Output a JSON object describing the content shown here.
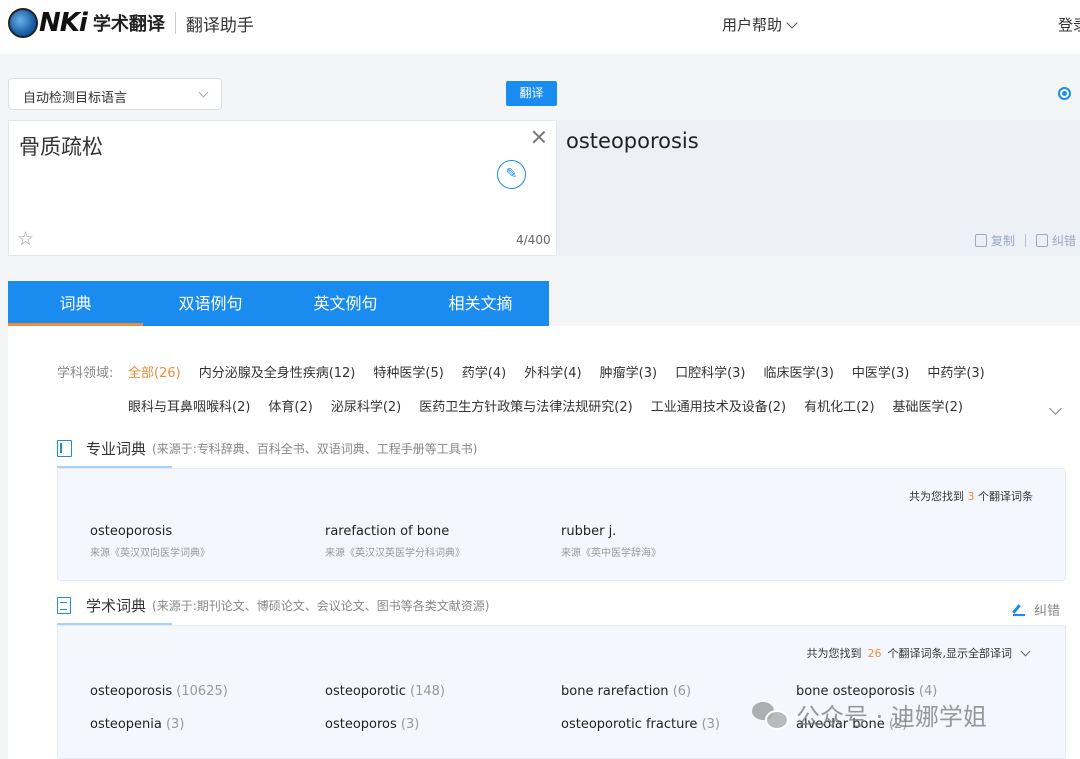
{
  "header": {
    "logo_text": "NKi",
    "app_name": "学术翻译",
    "sub_name": "翻译助手",
    "help_label": "用户帮助",
    "login_label": "登录"
  },
  "controls": {
    "target_language": "自动检测目标语言",
    "translate_label": "翻译"
  },
  "source": {
    "text": "骨质疏松",
    "char_count": "4/400"
  },
  "target": {
    "text": "osteoporosis",
    "copy_label": "复制",
    "correct_label": "纠错"
  },
  "tabs": [
    {
      "label": "词典",
      "active": true
    },
    {
      "label": "双语例句",
      "active": false
    },
    {
      "label": "英文例句",
      "active": false
    },
    {
      "label": "相关文摘",
      "active": false
    }
  ],
  "subjects": {
    "label": "学科领域:",
    "row1": [
      "全部(26)",
      "内分泌腺及全身性疾病(12)",
      "特种医学(5)",
      "药学(4)",
      "外科学(4)",
      "肿瘤学(3)",
      "口腔科学(3)",
      "临床医学(3)",
      "中医学(3)",
      "中药学(3)"
    ],
    "row2": [
      "眼科与耳鼻咽喉科(2)",
      "体育(2)",
      "泌尿科学(2)",
      "医药卫生方针政策与法律法规研究(2)",
      "工业通用技术及设备(2)",
      "有机化工(2)",
      "基础医学(2)"
    ]
  },
  "professional_dict": {
    "title": "专业词典",
    "source_note": "(来源于:专科辞典、百科全书、双语词典、工程手册等工具书)",
    "found_prefix": "共为您找到",
    "found_count": "3",
    "found_suffix": "个翻译词条",
    "terms": [
      {
        "term": "osteoporosis",
        "source": "来源《英汉双向医学词典》"
      },
      {
        "term": "rarefaction of bone",
        "source": "来源《英汉汉英医学分科词典》"
      },
      {
        "term": "rubber j.",
        "source": "来源《英中医学辞海》"
      }
    ]
  },
  "academic_dict": {
    "title": "学术词典",
    "source_note": "(来源于:期刊论文、博硕论文、会议论文、图书等各类文献资源)",
    "feedback_label": "纠错",
    "found_prefix": "共为您找到",
    "found_count": "26",
    "found_suffix": "个翻译词条,显示全部译词",
    "terms": [
      {
        "term": "osteoporosis",
        "count": "(10625)"
      },
      {
        "term": "osteoporotic",
        "count": "(148)"
      },
      {
        "term": "bone rarefaction",
        "count": "(6)"
      },
      {
        "term": "bone osteoporosis",
        "count": "(4)"
      },
      {
        "term": "osteopenia",
        "count": "(3)"
      },
      {
        "term": "osteoporos",
        "count": "(3)"
      },
      {
        "term": "osteoporotic fracture",
        "count": "(3)"
      },
      {
        "term": "alveolar bone",
        "count": "(2)"
      }
    ]
  },
  "watermark": {
    "text": "公众号 · 迪娜学姐"
  }
}
